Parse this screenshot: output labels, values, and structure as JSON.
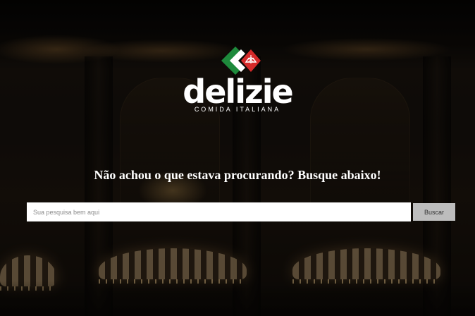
{
  "brand": {
    "name": "delizie",
    "tagline": "COMIDA ITALIANA",
    "colors": {
      "green": "#1e8a3c",
      "white": "#ffffff",
      "red": "#d42a2a"
    }
  },
  "search": {
    "heading": "Não achou o que estava procurando? Busque abaixo!",
    "placeholder": "Sua pesquisa bem aqui",
    "value": "",
    "button_label": "Buscar"
  }
}
